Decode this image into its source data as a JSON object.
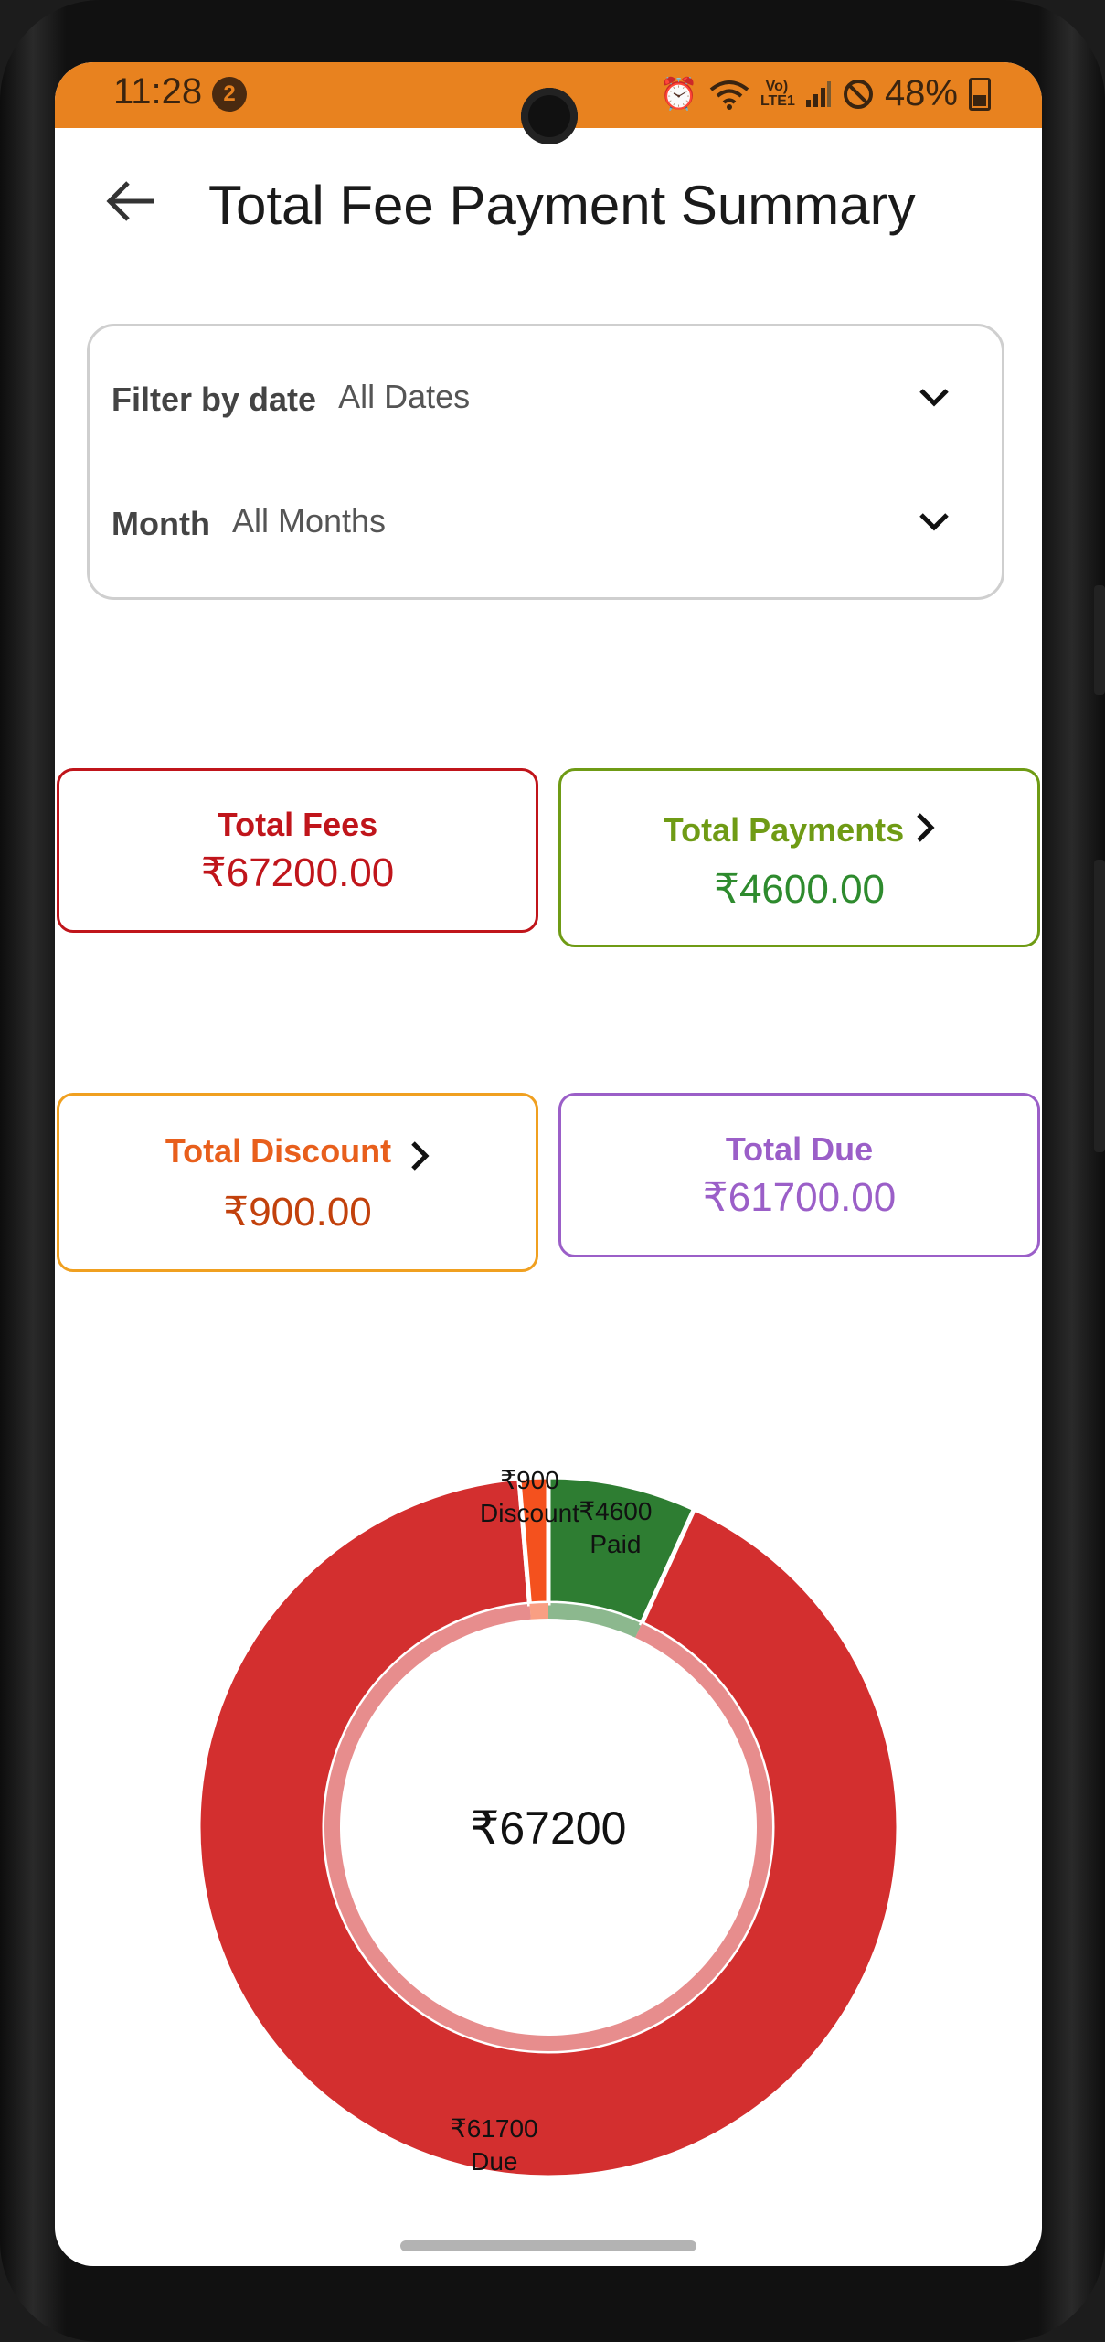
{
  "status_bar": {
    "time": "11:28",
    "notification_count": "2",
    "battery": "48%",
    "network": "Vo) LTE1"
  },
  "app_bar": {
    "title": "Total Fee Payment Summary",
    "back_icon": "arrow-left-icon"
  },
  "filters": {
    "date_label": "Filter by date",
    "date_value": "All Dates",
    "month_label": "Month",
    "month_value": "All Months"
  },
  "cards": {
    "total_fees": {
      "label": "Total Fees",
      "value": "₹67200.00",
      "color": "#c0151b"
    },
    "total_payments": {
      "label": "Total Payments",
      "value": "₹4600.00",
      "color": "#6f9b15",
      "value_color": "#2e8b2e"
    },
    "total_discount": {
      "label": "Total Discount",
      "value": "₹900.00",
      "color": "#e85f1c",
      "value_color": "#c2410c",
      "border_color": "#f0a020"
    },
    "total_due": {
      "label": "Total Due",
      "value": "₹61700.00",
      "color": "#9b5fc8"
    }
  },
  "chart_data": {
    "type": "pie",
    "center_label": "₹67200",
    "slices": [
      {
        "label": "Paid",
        "value": 4600,
        "value_label": "₹4600",
        "color": "#2e7d32"
      },
      {
        "label": "Due",
        "value": 61700,
        "value_label": "₹61700",
        "color": "#d32f2f"
      },
      {
        "label": "Discount",
        "value": 900,
        "value_label": "₹900",
        "color": "#f4511e"
      }
    ]
  }
}
